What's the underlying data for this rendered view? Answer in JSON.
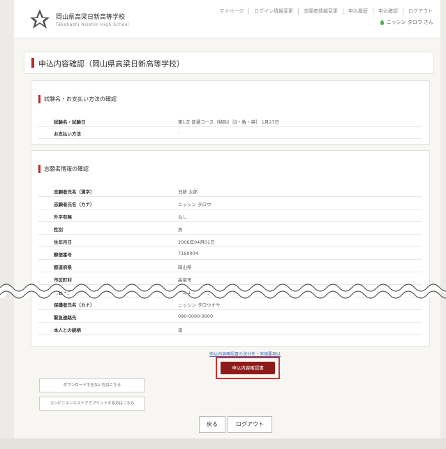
{
  "header": {
    "school_name": "岡山県高梁日新高等学校",
    "school_sub": "Takahashi Nisshin High School",
    "nav": [
      "マイページ",
      "ログイン情報変更",
      "志願者情報変更",
      "申込履歴",
      "申込確認",
      "ログアウト"
    ],
    "user_name": "ニッシン タロウ さん"
  },
  "page_title": "申込内容確認（岡山県高梁日新高等学校）",
  "exam_section": {
    "title": "試験名・お支払い方法の確認",
    "rows": [
      {
        "k": "試験名・試験日",
        "v": "第1次 普通コース（特別）［B・数・英］ 1月27日"
      },
      {
        "k": "お支払い方法",
        "v": "-"
      }
    ]
  },
  "applicant_section": {
    "title": "志願者情報の確認",
    "rows": [
      {
        "k": "志願者氏名（漢字）",
        "v": "日新 太郎"
      },
      {
        "k": "志願者氏名（カナ）",
        "v": "ニッシン タロウ"
      },
      {
        "k": "外字有無",
        "v": "なし"
      },
      {
        "k": "性別",
        "v": "男"
      },
      {
        "k": "生年月日",
        "v": "2006年04月01日"
      },
      {
        "k": "郵便番号",
        "v": "7160004"
      },
      {
        "k": "都道府県",
        "v": "岡山県"
      },
      {
        "k": "市区町村",
        "v": "高梁市"
      },
      {
        "k": "町名・番地",
        "v": "横町１５０番地"
      },
      {
        "k": "保護者氏名（カナ）",
        "v": "ニッシン タロウオヤ"
      },
      {
        "k": "緊急連絡先",
        "v": "090-0000-0000"
      },
      {
        "k": "本人との続柄",
        "v": "母"
      }
    ]
  },
  "link_text": "申込内容確認書の送付先・実施要項は",
  "confirm_button": "申込内容確認書",
  "download_note": "ダウンロードできない方はこちら",
  "convenience_note": "コンビニエンスストアでプリントする方はこちら",
  "back_button": "戻る",
  "logout_button": "ログアウト",
  "colors": {
    "accent": "#c62828",
    "button": "#8e1b1b"
  }
}
